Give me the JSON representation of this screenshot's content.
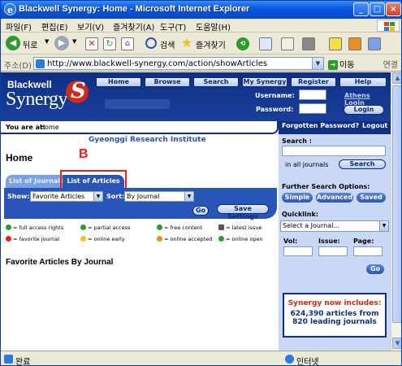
{
  "window": {
    "title": "Blackwell Synergy: Home - Microsoft Internet Explorer",
    "min": "_",
    "max": "□",
    "close": "×"
  },
  "menu": [
    "파일(F)",
    "편집(E)",
    "보기(V)",
    "즐겨찾기(A)",
    "도구(T)",
    "도움말(H)"
  ],
  "toolbar": {
    "back": "뒤로",
    "search": "검색",
    "favorites": "즐겨찾기"
  },
  "address": {
    "label": "주소(D)",
    "url": "http://www.blackwell-synergy.com/action/showArticles",
    "go": "이동",
    "links": "연결"
  },
  "site": {
    "logo_top": "Blackwell",
    "logo_bottom": "Synergy",
    "nav": [
      "Home",
      "Browse",
      "Search",
      "My Synergy",
      "Register",
      "Help"
    ],
    "username_label": "Username:",
    "password_label": "Password:",
    "athens_login": "Athens Login",
    "login_button": "Login",
    "forgot": "Forgotten Password?",
    "logout": "Logout"
  },
  "crumb": {
    "label": "You are at:",
    "value": "Home"
  },
  "institution": "Gyeonggi Research Institute",
  "heading": "Home",
  "annotation_letter": "B",
  "tabs": {
    "journals": "List of Journals",
    "articles": "List of Articles"
  },
  "filters": {
    "show_label": "Show:",
    "show_value": "Favorite Articles",
    "sort_label": "Sort:",
    "sort_value": "By Journal",
    "save": "Save Settings",
    "go": "Go"
  },
  "legend": [
    {
      "text": "= full access rights",
      "color": "#2e9a2e"
    },
    {
      "text": "= partial access",
      "color": "#2e9a2e"
    },
    {
      "text": "= free content",
      "color": "#2e9a2e"
    },
    {
      "text": "= latest issue",
      "color": "#555555"
    },
    {
      "text": "= favorite journal",
      "color": "#e8201a"
    },
    {
      "text": "= online early",
      "color": "#f0c020"
    },
    {
      "text": "= online accepted",
      "color": "#e89020"
    },
    {
      "text": "= online open",
      "color": "#2e9a2e"
    }
  ],
  "favorites_heading": "Favorite Articles By Journal",
  "sidebar": {
    "search_label": "Search :",
    "in_all": "in all journals",
    "search_button": "Search",
    "further": "Further Search Options:",
    "options": [
      "Simple",
      "Advanced",
      "Saved"
    ],
    "quicklink": "Quicklink:",
    "journal_select": "Select a Journal...",
    "vol": "Vol:",
    "issue": "Issue:",
    "page": "Page:",
    "go": "Go"
  },
  "promo": {
    "headline": "Synergy now includes:",
    "line1": "624,390 articles from",
    "line2": "820 leading journals"
  },
  "status": {
    "done": "완료",
    "zone": "인터넷"
  },
  "colors": {
    "brand": "#0d2f86",
    "accent": "#2a55b8",
    "highlight": "#e8201a"
  }
}
